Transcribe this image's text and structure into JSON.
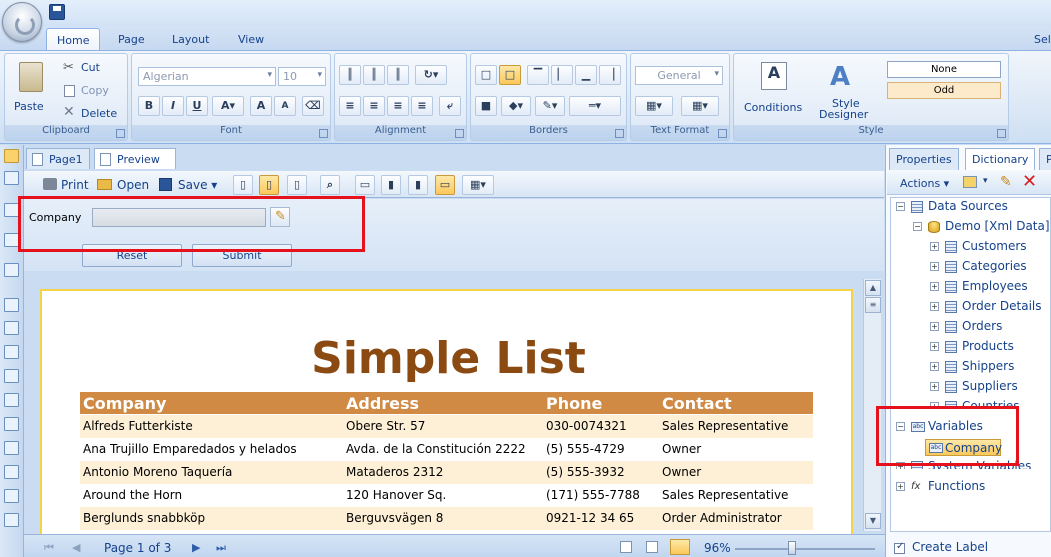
{
  "ribbon": {
    "tabs": [
      "Home",
      "Page",
      "Layout",
      "View"
    ],
    "sel_text": "Sel",
    "clipboard": {
      "paste": "Paste",
      "cut": "Cut",
      "copy": "Copy",
      "delete": "Delete",
      "label": "Clipboard"
    },
    "font": {
      "family": "Algerian",
      "size": "10",
      "label": "Font"
    },
    "alignment": {
      "label": "Alignment"
    },
    "borders": {
      "label": "Borders"
    },
    "text_format": {
      "general": "General",
      "label": "Text Format"
    },
    "style": {
      "conditions": "Conditions",
      "style_designer_1": "Style",
      "style_designer_2": "Designer",
      "none": "None",
      "odd": "Odd",
      "label": "Style"
    }
  },
  "doc_tabs": [
    "Page1",
    "Preview"
  ],
  "preview_toolbar": {
    "print": "Print",
    "open": "Open",
    "save": "Save"
  },
  "params": {
    "company_label": "Company",
    "reset": "Reset",
    "submit": "Submit"
  },
  "report": {
    "title": "Simple List",
    "headers": [
      "Company",
      "Address",
      "Phone",
      "Contact"
    ],
    "rows": [
      [
        "Alfreds Futterkiste",
        "Obere Str. 57",
        "030-0074321",
        "Sales Representative"
      ],
      [
        "Ana Trujillo Emparedados y helados",
        "Avda. de la Constitución 2222",
        "(5) 555-4729",
        "Owner"
      ],
      [
        "Antonio Moreno Taquería",
        "Mataderos  2312",
        "(5) 555-3932",
        "Owner"
      ],
      [
        "Around the Horn",
        "120 Hanover Sq.",
        "(171) 555-7788",
        "Sales Representative"
      ],
      [
        "Berglunds snabbköp",
        "Berguvsvägen  8",
        "0921-12 34 65",
        "Order Administrator"
      ]
    ]
  },
  "status": {
    "page_info": "Page 1 of 3",
    "zoom": "96%"
  },
  "right_panel": {
    "tabs": [
      "Properties",
      "Dictionary",
      "P"
    ],
    "actions": "Actions",
    "tree": {
      "data_sources": "Data Sources",
      "demo": "Demo [Xml Data]",
      "tables": [
        "Customers",
        "Categories",
        "Employees",
        "Order Details",
        "Orders",
        "Products",
        "Shippers",
        "Suppliers",
        "Countries"
      ],
      "variables": "Variables",
      "company": "Company",
      "system_variables": "System Variables",
      "functions": "Functions"
    },
    "create_label": "Create Label"
  }
}
